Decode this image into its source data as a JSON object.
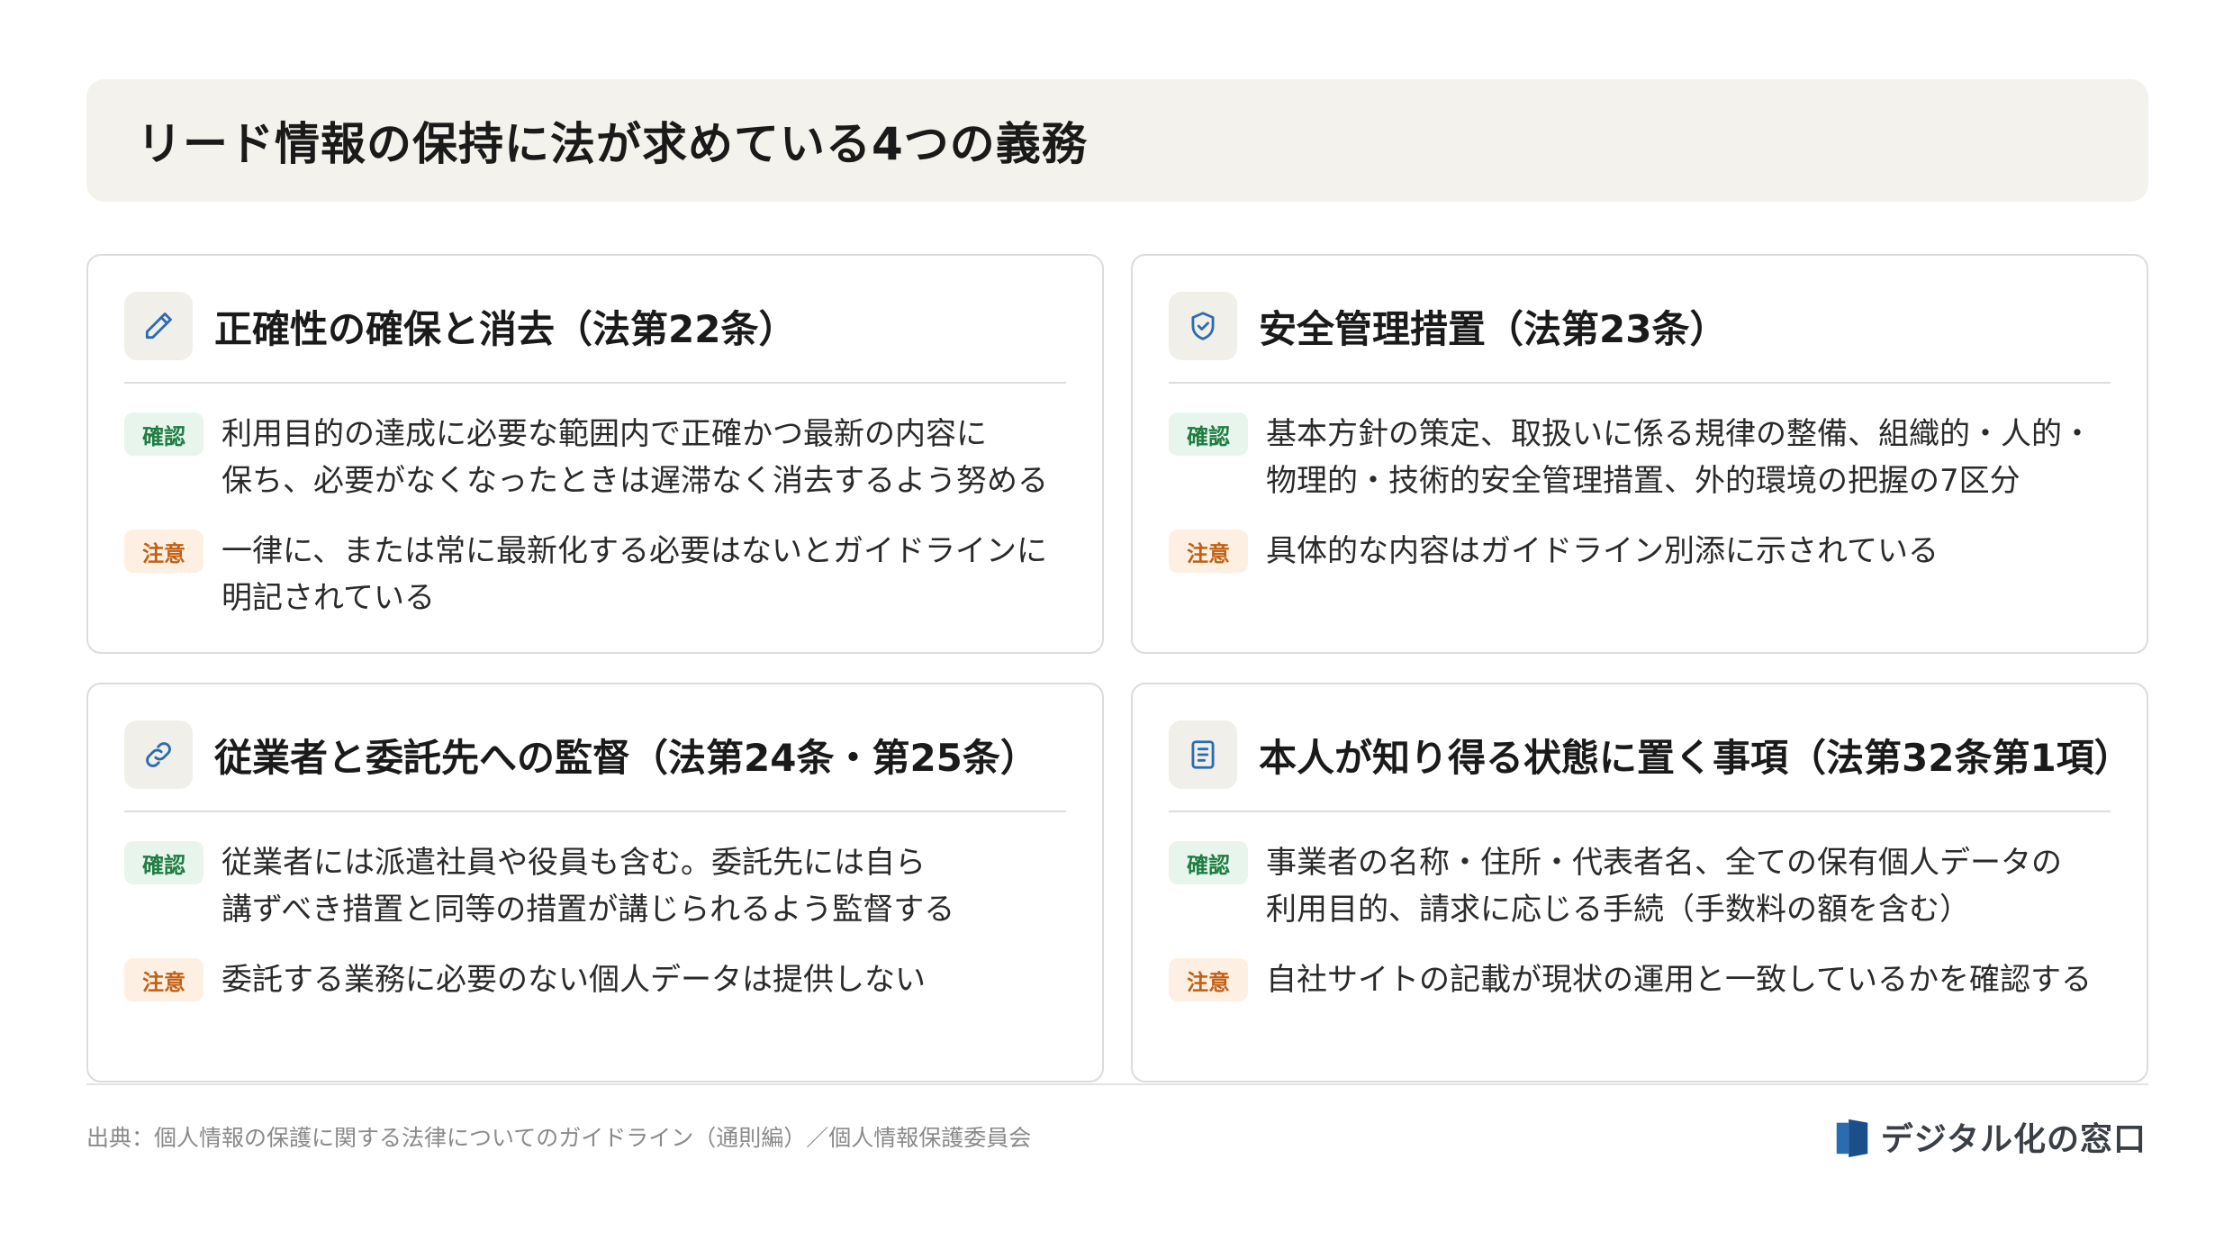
{
  "page_title": "リード情報の保持に法が求めている4つの義務",
  "cards": [
    {
      "icon": "pencil-icon",
      "title": "正確性の確保と消去（法第22条）",
      "confirm_label": "確認",
      "confirm_text": "利用目的の達成に必要な範囲内で正確かつ最新の内容に\n保ち、必要がなくなったときは遅滞なく消去するよう努める",
      "caution_label": "注意",
      "caution_text": "一律に、または常に最新化する必要はないとガイドラインに\n明記されている"
    },
    {
      "icon": "shield-check-icon",
      "title": "安全管理措置（法第23条）",
      "confirm_label": "確認",
      "confirm_text": "基本方針の策定、取扱いに係る規律の整備、組織的・人的・\n物理的・技術的安全管理措置、外的環境の把握の7区分",
      "caution_label": "注意",
      "caution_text": "具体的な内容はガイドライン別添に示されている"
    },
    {
      "icon": "link-icon",
      "title": "従業者と委託先への監督（法第24条・第25条）",
      "confirm_label": "確認",
      "confirm_text": "従業者には派遣社員や役員も含む。委託先には自ら\n講ずべき措置と同等の措置が講じられるよう監督する",
      "caution_label": "注意",
      "caution_text": "委託する業務に必要のない個人データは提供しない"
    },
    {
      "icon": "document-icon",
      "title": "本人が知り得る状態に置く事項（法第32条第1項）",
      "confirm_label": "確認",
      "confirm_text": "事業者の名称・住所・代表者名、全ての保有個人データの\n利用目的、請求に応じる手続（手数料の額を含む）",
      "caution_label": "注意",
      "caution_text": "自社サイトの記載が現状の運用と一致しているかを確認する"
    }
  ],
  "footer": {
    "source": "出典：個人情報の保護に関する法律についてのガイドライン（通則編）／個人情報保護委員会",
    "brand": "デジタル化の窓口",
    "brand_icon": "window-logo-icon"
  },
  "colors": {
    "title_bg": "#f4f2ec",
    "icon_accent": "#2b6cb0",
    "confirm_badge_bg": "#e8f5ec",
    "confirm_badge_text": "#1e7d42",
    "caution_badge_bg": "#fdf0e3",
    "caution_badge_text": "#c45f12"
  }
}
